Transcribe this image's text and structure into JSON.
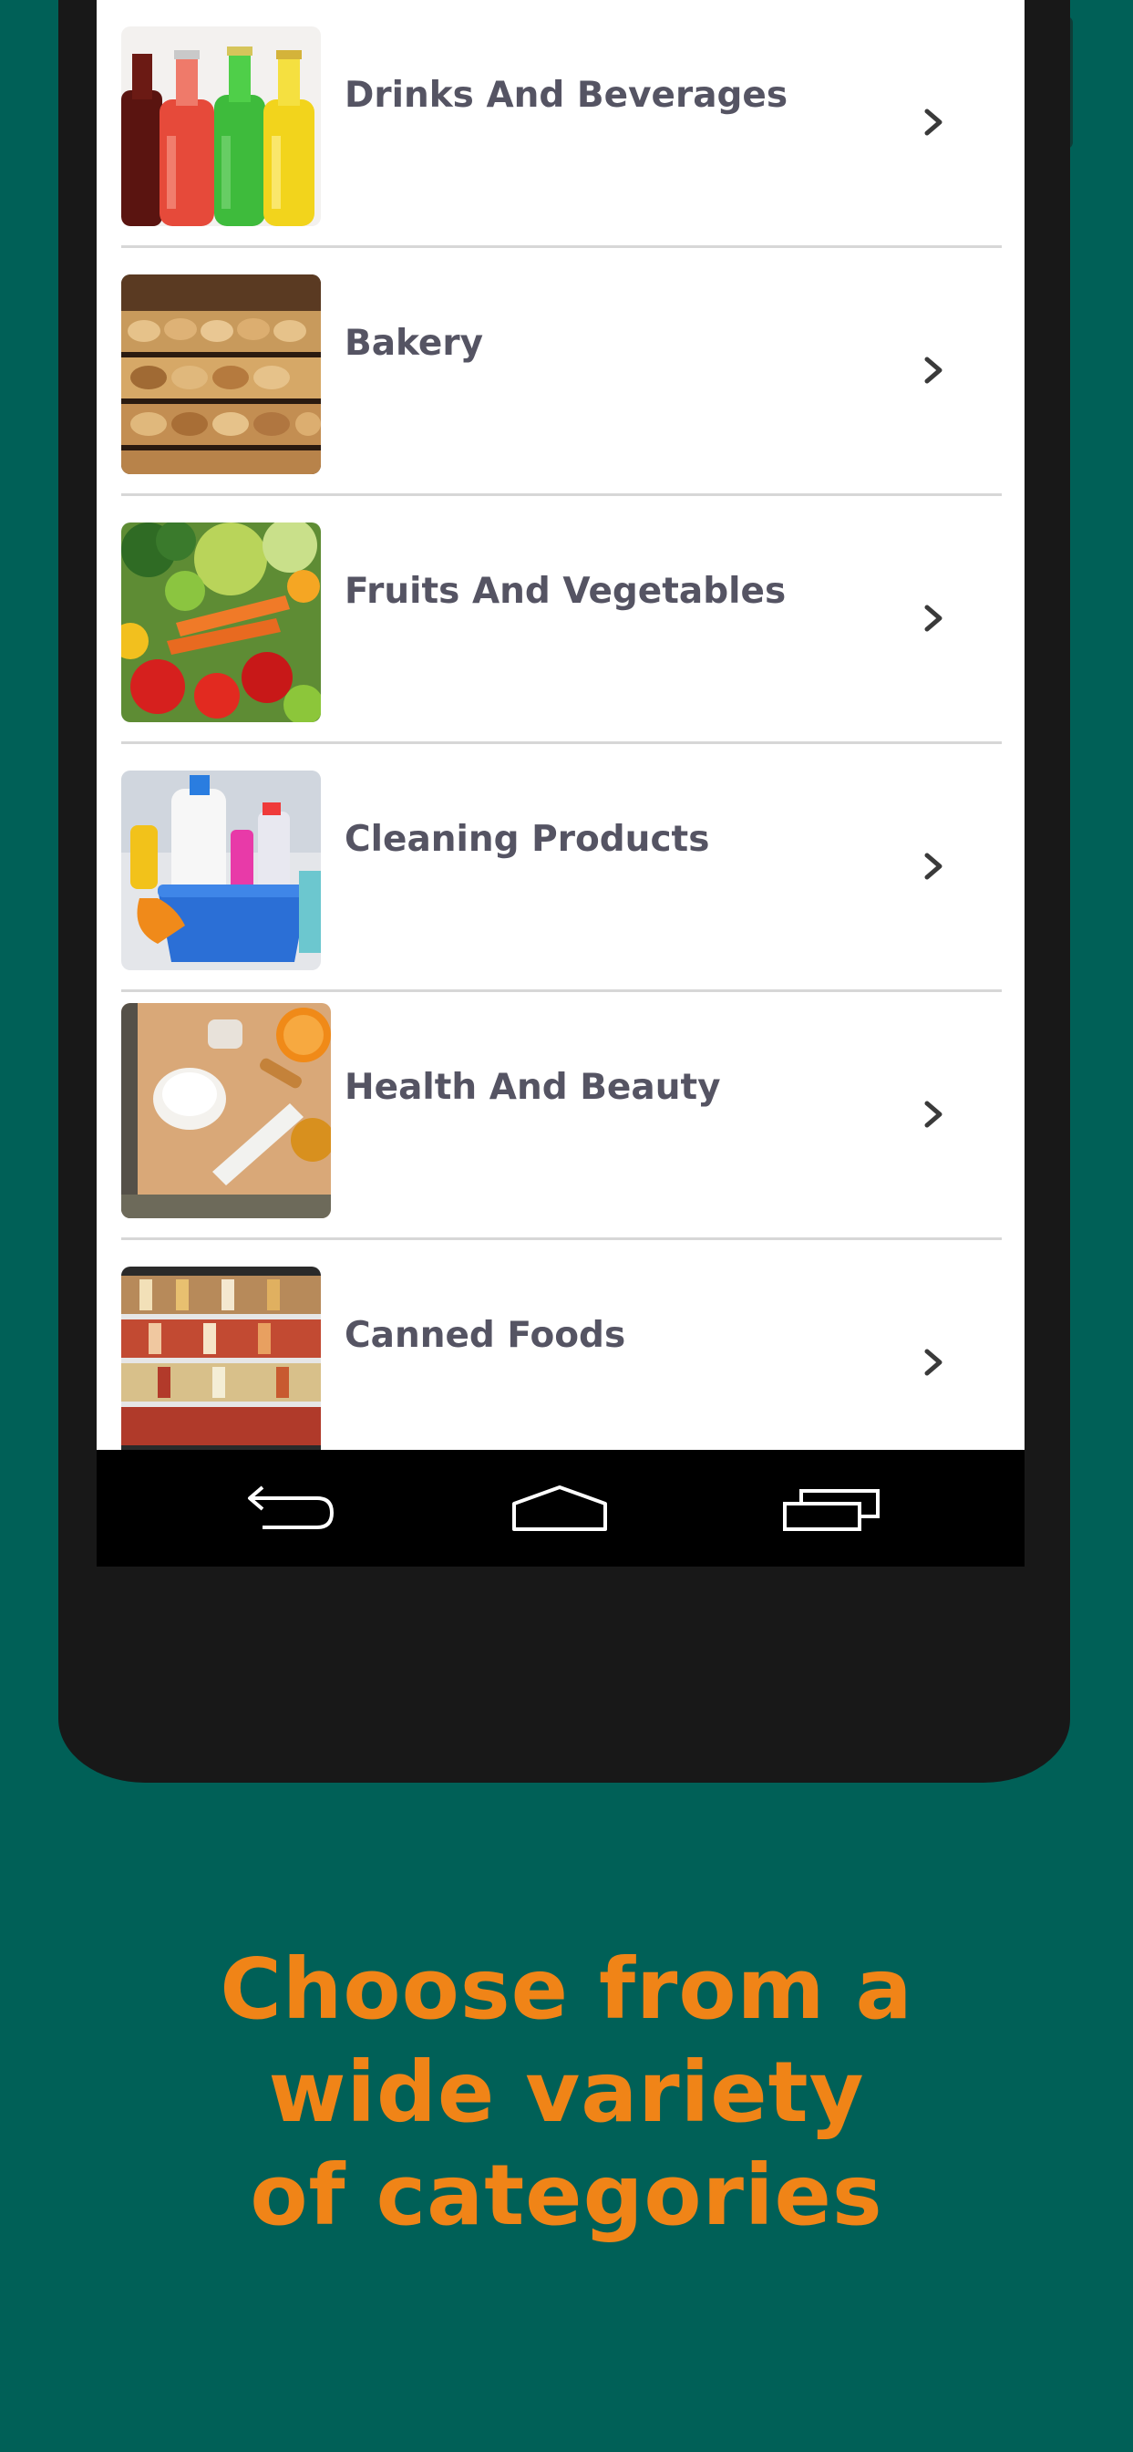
{
  "colors": {
    "background": "#006057",
    "phone_body": "#181818",
    "headline": "#f08417",
    "label": "#555463",
    "divider": "#d7d7d7"
  },
  "categories": [
    {
      "label": "Drinks And Beverages",
      "image": "soda-bottles"
    },
    {
      "label": "Bakery",
      "image": "bread-shelves"
    },
    {
      "label": "Fruits And Vegetables",
      "image": "fresh-produce"
    },
    {
      "label": "Cleaning Products",
      "image": "cleaning-supplies"
    },
    {
      "label": "Health And Beauty",
      "image": "cosmetics"
    },
    {
      "label": "Canned Foods",
      "image": "canned-goods-shelves"
    }
  ],
  "navbar": {
    "back_icon": "back-icon",
    "home_icon": "home-icon",
    "recents_icon": "recents-icon"
  },
  "headline": {
    "line1": "Choose from a",
    "line2": "wide variety",
    "line3": "of categories"
  }
}
